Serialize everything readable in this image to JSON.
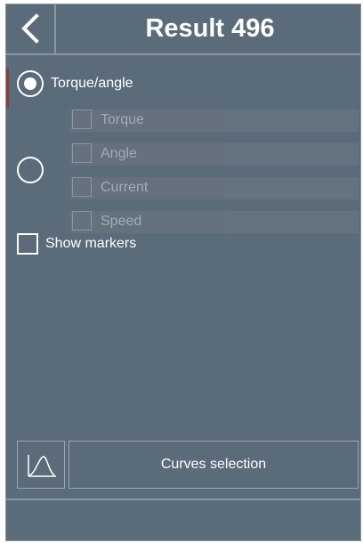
{
  "header": {
    "back_icon": "chevron-left-icon",
    "title": "Result 496"
  },
  "mode": {
    "torque_angle_label": "Torque/angle",
    "torque_angle_selected": true,
    "custom_selected": false,
    "custom_options": [
      {
        "label": "Torque",
        "checked": false
      },
      {
        "label": "Angle",
        "checked": false
      },
      {
        "label": "Current",
        "checked": false
      },
      {
        "label": "Speed",
        "checked": false
      }
    ]
  },
  "show_markers": {
    "label": "Show markers",
    "checked": false
  },
  "bottom": {
    "curve_icon": "curve-icon",
    "curves_selection_label": "Curves selection"
  },
  "colors": {
    "background": "#5a6b79",
    "divider": "#8995a0",
    "text": "#ffffff",
    "disabled_text": "#a5afb8",
    "accent": "#8e3a3a"
  }
}
